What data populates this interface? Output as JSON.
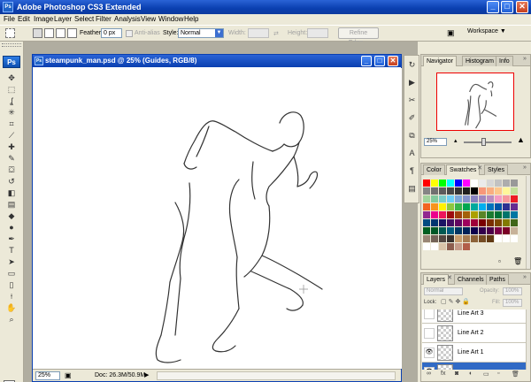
{
  "app": {
    "title": "Adobe Photoshop CS3 Extended",
    "logo": "Ps",
    "window_controls": [
      "_",
      "□",
      "✕"
    ]
  },
  "menu": [
    "File",
    "Edit",
    "Image",
    "Layer",
    "Select",
    "Filter",
    "Analysis",
    "View",
    "Window",
    "Help"
  ],
  "options_bar": {
    "feather_label": "Feather:",
    "feather_value": "0 px",
    "antialias_label": "Anti-alias",
    "style_label": "Style:",
    "style_value": "Normal",
    "width_label": "Width:",
    "height_label": "Height:",
    "refine_edge_label": "Refine Edge...",
    "workspace_label": "Workspace ▼"
  },
  "document": {
    "title": "steampunk_man.psd @ 25% (Guides, RGB/8)",
    "zoom": "25%",
    "doc_info": "Doc: 26.3M/50.9M",
    "controls": [
      "_",
      "□",
      "✕"
    ]
  },
  "toolbox": {
    "tools": [
      {
        "name": "move-tool-icon",
        "glyph": "✥"
      },
      {
        "name": "marquee-tool-icon",
        "glyph": "⬚"
      },
      {
        "name": "lasso-tool-icon",
        "glyph": "ʆ"
      },
      {
        "name": "magic-wand-tool-icon",
        "glyph": "✳"
      },
      {
        "name": "crop-tool-icon",
        "glyph": "⌗"
      },
      {
        "name": "slice-tool-icon",
        "glyph": "⟋"
      },
      {
        "name": "healing-brush-tool-icon",
        "glyph": "✚"
      },
      {
        "name": "brush-tool-icon",
        "glyph": "✎"
      },
      {
        "name": "clone-stamp-tool-icon",
        "glyph": "⛋"
      },
      {
        "name": "history-brush-tool-icon",
        "glyph": "↺"
      },
      {
        "name": "eraser-tool-icon",
        "glyph": "◧"
      },
      {
        "name": "gradient-tool-icon",
        "glyph": "▤"
      },
      {
        "name": "blur-tool-icon",
        "glyph": "◆"
      },
      {
        "name": "dodge-tool-icon",
        "glyph": "●"
      },
      {
        "name": "pen-tool-icon",
        "glyph": "✒"
      },
      {
        "name": "type-tool-icon",
        "glyph": "T"
      },
      {
        "name": "path-selection-tool-icon",
        "glyph": "➤"
      },
      {
        "name": "shape-tool-icon",
        "glyph": "▭"
      },
      {
        "name": "notes-tool-icon",
        "glyph": "▯"
      },
      {
        "name": "eyedropper-tool-icon",
        "glyph": "⟊"
      },
      {
        "name": "hand-tool-icon",
        "glyph": "✋"
      },
      {
        "name": "zoom-tool-icon",
        "glyph": "⌕"
      }
    ],
    "fg_color": "#000000",
    "bg_color": "#ffffff"
  },
  "dock_icons": [
    {
      "name": "history-icon",
      "glyph": "↻"
    },
    {
      "name": "actions-icon",
      "glyph": "▶"
    },
    {
      "name": "tool-presets-icon",
      "glyph": "✂"
    },
    {
      "name": "brushes-icon",
      "glyph": "✐"
    },
    {
      "name": "clone-source-icon",
      "glyph": "⧉"
    },
    {
      "name": "character-icon",
      "glyph": "A"
    },
    {
      "name": "paragraph-icon",
      "glyph": "¶"
    },
    {
      "name": "layer-comps-icon",
      "glyph": "▤"
    }
  ],
  "navigator_panel": {
    "tabs": [
      "Navigator",
      "Histogram",
      "Info"
    ],
    "zoom": "25%"
  },
  "color_panel": {
    "tabs": [
      "Color",
      "Swatches",
      "Styles"
    ],
    "swatch_colors": [
      "#ff0000",
      "#ffff00",
      "#00ff00",
      "#00ffff",
      "#0000ff",
      "#ff00ff",
      "#ffffff",
      "#ebebeb",
      "#d6d6d6",
      "#c2c2c2",
      "#adadad",
      "#999999",
      "#858585",
      "#707070",
      "#5c5c5c",
      "#474747",
      "#333333",
      "#1f1f1f",
      "#000000",
      "#f7977a",
      "#f9ad81",
      "#fdc68a",
      "#fff79a",
      "#c4df9b",
      "#a2d39c",
      "#82ca9d",
      "#7bcdc8",
      "#6ecff6",
      "#7ea7d8",
      "#8493ca",
      "#8882be",
      "#a187be",
      "#bc8dbf",
      "#f49ac2",
      "#f6989d",
      "#ed1c24",
      "#f26522",
      "#f7941d",
      "#fff200",
      "#8dc73f",
      "#39b54a",
      "#00a651",
      "#00a99d",
      "#00aeef",
      "#0072bc",
      "#0054a6",
      "#2e3192",
      "#662d91",
      "#92278f",
      "#ec008c",
      "#ed145b",
      "#9e0b0f",
      "#a0410d",
      "#a36209",
      "#aba000",
      "#598527",
      "#1a7b30",
      "#007236",
      "#00746b",
      "#0076a3",
      "#004b80",
      "#003471",
      "#1b1464",
      "#440e62",
      "#630460",
      "#9e005d",
      "#9e0039",
      "#790000",
      "#7b2e00",
      "#7d4900",
      "#827b00",
      "#406618",
      "#005e20",
      "#005826",
      "#005952",
      "#005b7f",
      "#003663",
      "#002157",
      "#0d004c",
      "#32004b",
      "#4b0049",
      "#7b0046",
      "#7a0026",
      "#c7b299",
      "#998675",
      "#736357",
      "#534741",
      "#37302d",
      "#c69c6d",
      "#a67c52",
      "#8c6239",
      "#754c24",
      "#603913",
      "#ffffff",
      "#ffffff",
      "#ffffff",
      "#ffffff",
      "#ffffff",
      "#d9c4a9",
      "#8c5d4e",
      "#c59b89",
      "#b25e4a"
    ]
  },
  "layers_panel": {
    "tabs": [
      "Layers",
      "Channels",
      "Paths"
    ],
    "blend_mode": "Normal",
    "opacity_label": "Opacity:",
    "opacity_value": "100%",
    "lock_label": "Lock:",
    "fill_label": "Fill:",
    "fill_value": "100%",
    "layers": [
      {
        "name": "Line Art 3",
        "visible": false,
        "selected": false
      },
      {
        "name": "Line Art 2",
        "visible": false,
        "selected": false
      },
      {
        "name": "Line Art 1",
        "visible": true,
        "selected": false
      },
      {
        "name": "",
        "visible": true,
        "selected": true
      }
    ],
    "footer_icons": [
      "link-icon",
      "fx-icon",
      "mask-icon",
      "adjustment-icon",
      "group-icon",
      "new-layer-icon",
      "trash-icon"
    ]
  }
}
